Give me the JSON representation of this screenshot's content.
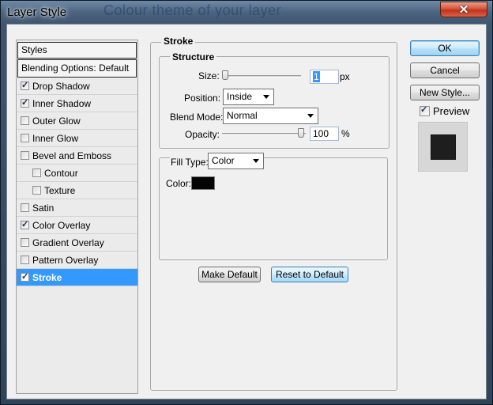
{
  "window": {
    "title": "Layer Style",
    "background_text": "Colour theme of your layer"
  },
  "styles_panel": {
    "header": "Styles",
    "blending_options": "Blending Options: Default",
    "items": [
      {
        "label": "Drop Shadow",
        "checked": true
      },
      {
        "label": "Inner Shadow",
        "checked": true
      },
      {
        "label": "Outer Glow",
        "checked": false
      },
      {
        "label": "Inner Glow",
        "checked": false
      },
      {
        "label": "Bevel and Emboss",
        "checked": false
      },
      {
        "label": "Contour",
        "checked": false
      },
      {
        "label": "Texture",
        "checked": false
      },
      {
        "label": "Satin",
        "checked": false
      },
      {
        "label": "Color Overlay",
        "checked": true
      },
      {
        "label": "Gradient Overlay",
        "checked": false
      },
      {
        "label": "Pattern Overlay",
        "checked": false
      },
      {
        "label": "Stroke",
        "checked": true
      }
    ]
  },
  "stroke": {
    "title": "Stroke",
    "structure_title": "Structure",
    "size_label": "Size:",
    "size_value": "1",
    "size_unit": "px",
    "size_slider_fraction": 0,
    "position_label": "Position:",
    "position_value": "Inside",
    "blend_mode_label": "Blend Mode:",
    "blend_mode_value": "Normal",
    "opacity_label": "Opacity:",
    "opacity_value": "100",
    "opacity_unit": "%",
    "opacity_slider_fraction": 1,
    "fill_type_label": "Fill Type:",
    "fill_type_value": "Color",
    "color_label": "Color:",
    "color_value": "#050505",
    "make_default_label": "Make Default",
    "reset_default_label": "Reset to Default"
  },
  "actions": {
    "ok_label": "OK",
    "cancel_label": "Cancel",
    "new_style_label": "New Style...",
    "preview_label": "Preview",
    "preview_checked": true
  }
}
